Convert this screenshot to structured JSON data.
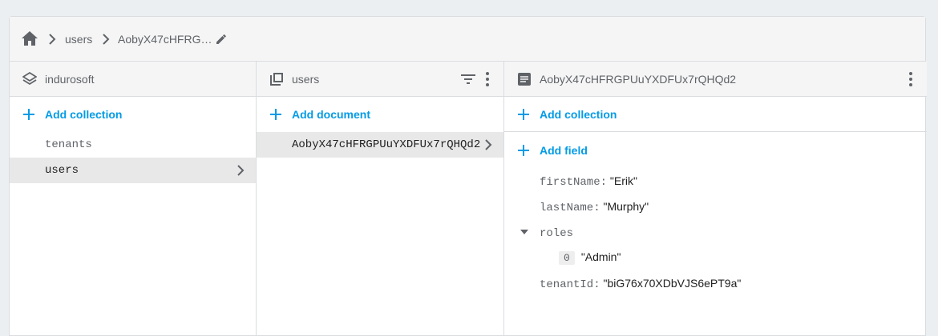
{
  "breadcrumb": {
    "items": [
      "users",
      "AobyX47cHFRG…"
    ]
  },
  "col1": {
    "title": "indurosoft",
    "add_label": "Add collection",
    "items": [
      {
        "label": "tenants",
        "selected": false
      },
      {
        "label": "users",
        "selected": true
      }
    ]
  },
  "col2": {
    "title": "users",
    "add_label": "Add document",
    "items": [
      {
        "label": "AobyX47cHFRGPUuYXDFUx7rQHQd2",
        "selected": true
      }
    ]
  },
  "col3": {
    "title": "AobyX47cHFRGPUuYXDFUx7rQHQd2",
    "add_collection_label": "Add collection",
    "add_field_label": "Add field",
    "fields": {
      "firstName_key": "firstName:",
      "firstName_val": "\"Erik\"",
      "lastName_key": "lastName:",
      "lastName_val": "\"Murphy\"",
      "roles_key": "roles",
      "roles_index": "0",
      "roles_val": "\"Admin\"",
      "tenantId_key": "tenantId:",
      "tenantId_val": "\"biG76x70XDbVJS6ePT9a\""
    }
  },
  "colors": {
    "accent": "#039be5",
    "selected_bg": "#e8e8e8",
    "header_bg": "#f5f5f5"
  },
  "icons": [
    "home-icon",
    "chevron-right-icon",
    "pencil-icon",
    "layers-icon",
    "collection-icon",
    "filter-icon",
    "more-vert-icon",
    "document-icon",
    "plus-icon",
    "caret-down-icon"
  ]
}
